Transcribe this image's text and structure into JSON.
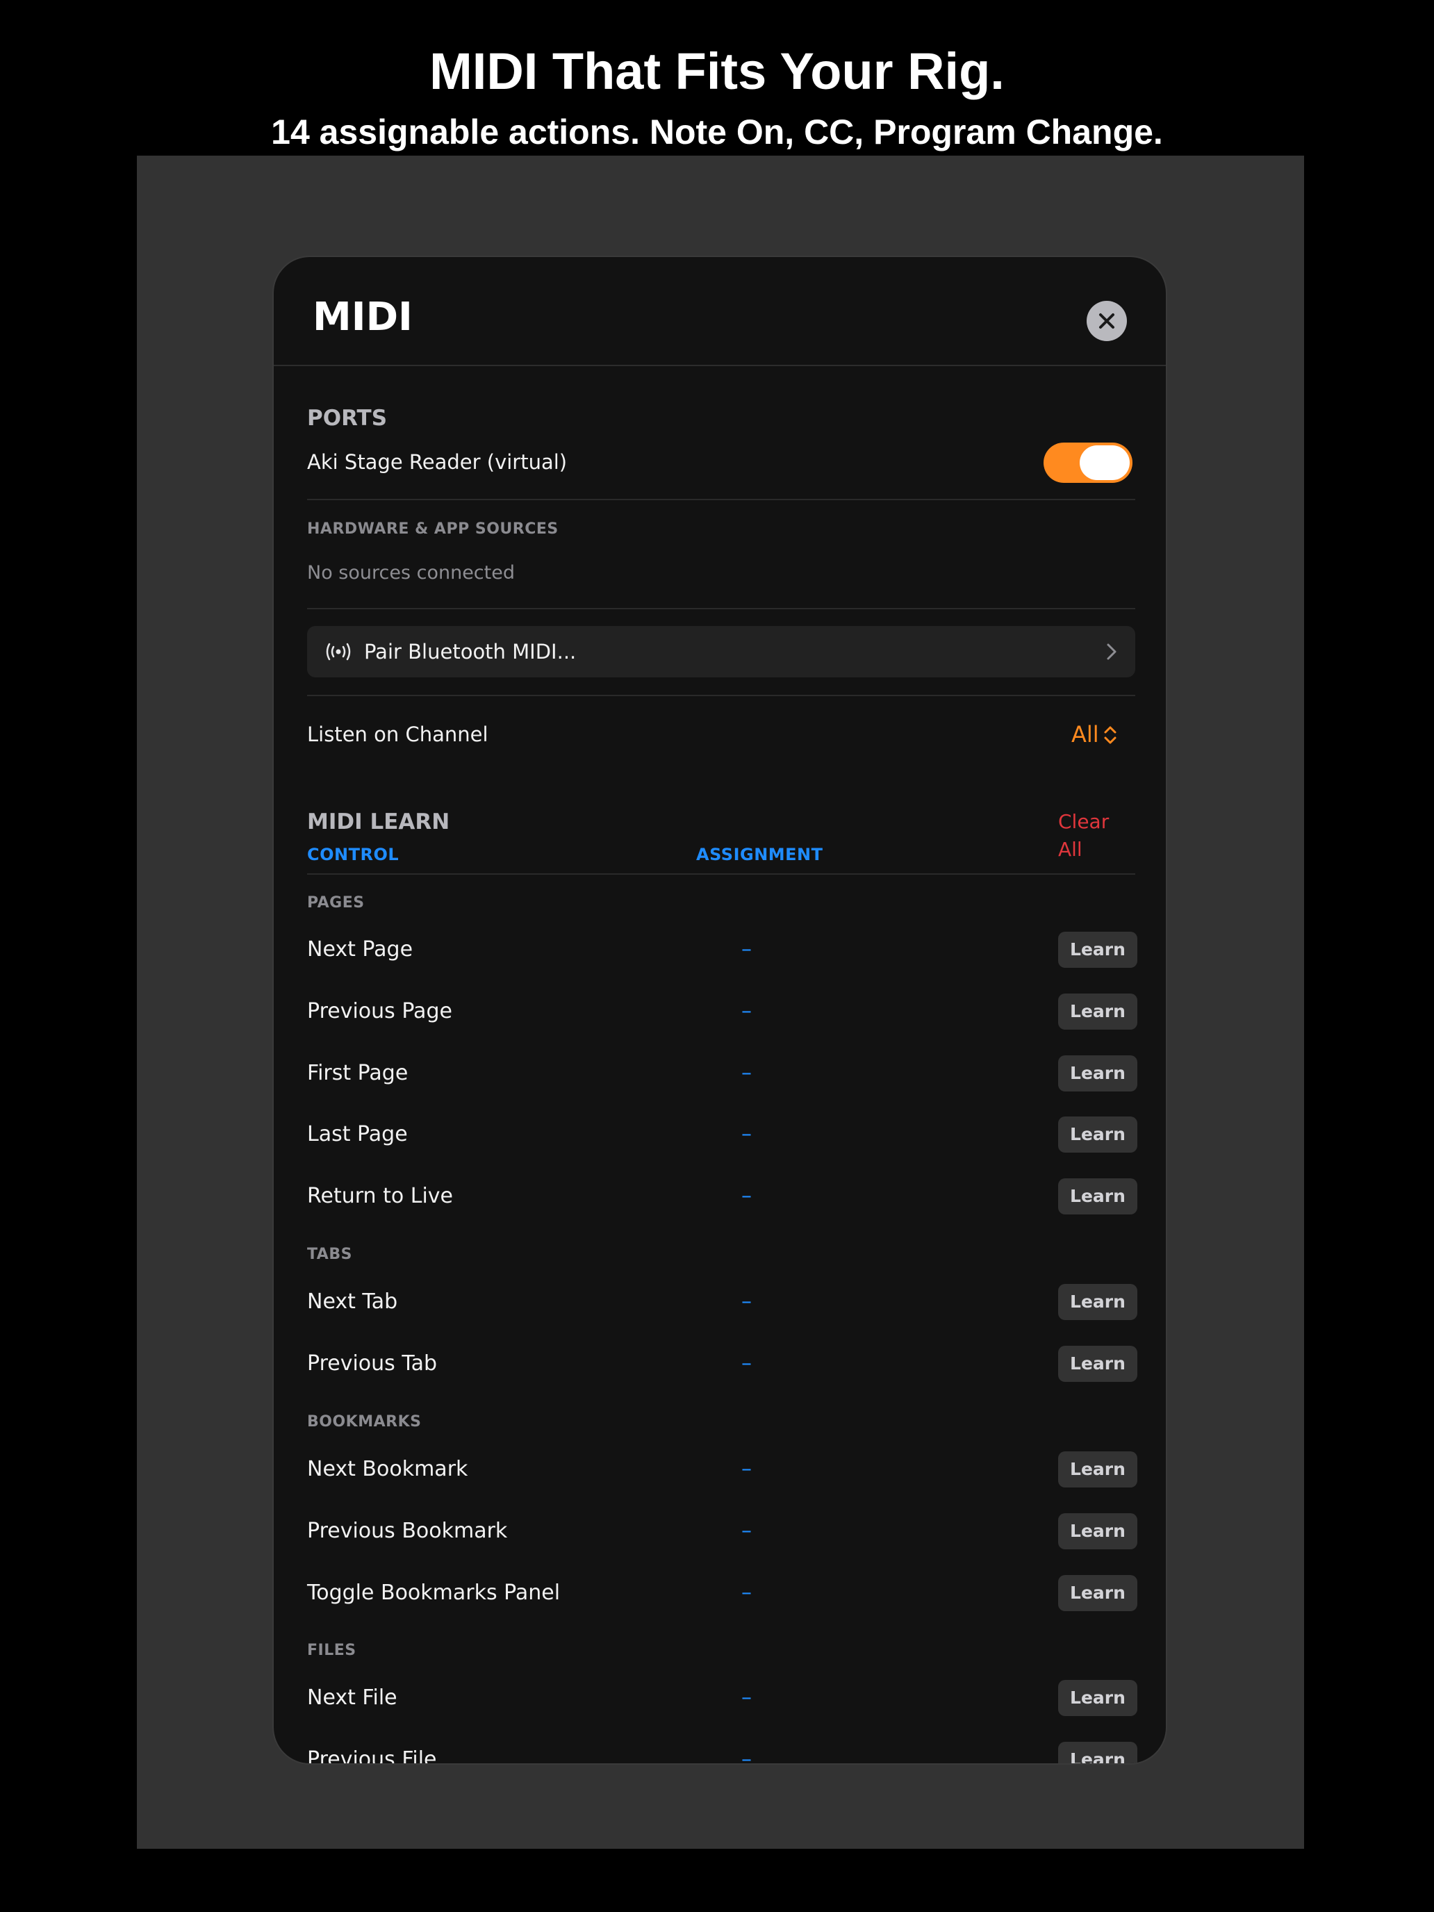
{
  "promo": {
    "headline": "MIDI That Fits Your Rig.",
    "subheadline": "14 assignable actions. Note On, CC, Program Change."
  },
  "sheet": {
    "title": "MIDI",
    "close_icon": "close-icon"
  },
  "ports": {
    "section_title": "PORTS",
    "virtual_port_label": "Aki Stage Reader (virtual)",
    "virtual_port_enabled": true,
    "sources_title": "HARDWARE & APP SOURCES",
    "sources_empty": "No sources connected",
    "pair_label": "Pair Bluetooth MIDI...",
    "pair_icon": "bluetooth-broadcast-icon",
    "channel_label": "Listen on Channel",
    "channel_value": "All"
  },
  "midi_learn": {
    "section_title": "MIDI LEARN",
    "clear_all_label": "Clear All",
    "columns": {
      "control": "CONTROL",
      "assignment": "ASSIGNMENT"
    },
    "learn_label": "Learn",
    "groups": [
      {
        "label": "PAGES",
        "actions": [
          {
            "label": "Next Page",
            "assignment": "–"
          },
          {
            "label": "Previous Page",
            "assignment": "–"
          },
          {
            "label": "First Page",
            "assignment": "–"
          },
          {
            "label": "Last Page",
            "assignment": "–"
          },
          {
            "label": "Return to Live",
            "assignment": "–"
          }
        ]
      },
      {
        "label": "TABS",
        "actions": [
          {
            "label": "Next Tab",
            "assignment": "–"
          },
          {
            "label": "Previous Tab",
            "assignment": "–"
          }
        ]
      },
      {
        "label": "BOOKMARKS",
        "actions": [
          {
            "label": "Next Bookmark",
            "assignment": "–"
          },
          {
            "label": "Previous Bookmark",
            "assignment": "–"
          },
          {
            "label": "Toggle Bookmarks Panel",
            "assignment": "–"
          }
        ]
      },
      {
        "label": "FILES",
        "actions": [
          {
            "label": "Next File",
            "assignment": "–"
          },
          {
            "label": "Previous File",
            "assignment": "–"
          }
        ]
      }
    ]
  },
  "colors": {
    "accent_orange": "#ff8a1f",
    "accent_blue": "#1f8cff",
    "destructive_red": "#e0363c",
    "sheet_background": "#121212",
    "backdrop": "#333333"
  }
}
